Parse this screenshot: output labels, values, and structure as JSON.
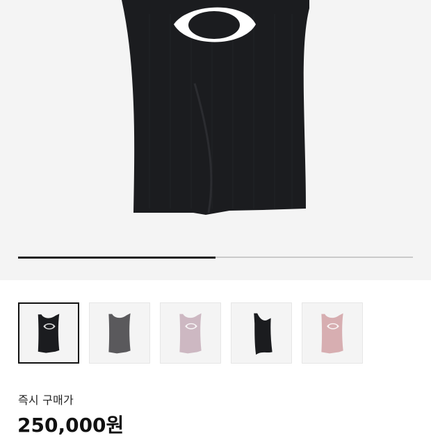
{
  "gallery": {
    "image_count": 5,
    "selected_index": 0,
    "progress_fraction": 0.5,
    "thumbnails": [
      {
        "color": "#1b1c1f",
        "style": "cutout-logo"
      },
      {
        "color": "#5a595c",
        "style": "plain"
      },
      {
        "color": "#cdb8c2",
        "style": "cutout-logo"
      },
      {
        "color": "#1b1c1f",
        "style": "wrap"
      },
      {
        "color": "#d7aeb1",
        "style": "cutout-logo"
      }
    ]
  },
  "purchase": {
    "label": "즉시 구매가",
    "price": "250,000원"
  },
  "colors": {
    "accent": "#111111",
    "background": "#ffffff",
    "image_background": "#f4f4f4"
  }
}
